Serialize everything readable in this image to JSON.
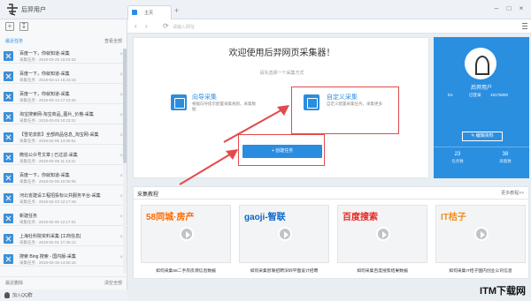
{
  "app": {
    "title": "后羿用户"
  },
  "tabs": [
    {
      "label": "主页"
    }
  ],
  "address": {
    "placeholder": "请输入网址"
  },
  "sidebar": {
    "section_title": "最近任务",
    "section_action": "查看全部",
    "tasks": [
      {
        "name": "百度一下，你就知道-采集",
        "date": "采集任务 · 2018-03-25 15:03:33"
      },
      {
        "name": "百度一下，你就知道-采集",
        "date": "采集任务 · 2018-03-14 15:23:16"
      },
      {
        "name": "百度一下，你就知道-采集",
        "date": "采集任务 · 2018-03-14 17:23:45"
      },
      {
        "name": "淘宝搜索网-淘宝商品_图片_价格-采集",
        "date": "采集任务 · 2018-03-08 10:23:21"
      },
      {
        "name": "【雪花泉影】全部商品信息_淘宝网-采集",
        "date": "采集任务 · 2018-02-06 14:09:51"
      },
      {
        "name": "微信公众号文章 | 已过滤-采集",
        "date": "采集任务 · 2018-02-06 11:13:31"
      },
      {
        "name": "百度一下，你就知道-采集",
        "date": "采集任务 · 2018-02-05 10:05:06"
      },
      {
        "name": "河北省建设工程招投标公共服务平台-采集",
        "date": "采集任务 · 2018-02-03 12:17:49"
      },
      {
        "name": "新建任务",
        "date": "采集任务 · 2018-02-06 12:17:01"
      },
      {
        "name": "上海社科院资料采集·[工商信息]",
        "date": "采集任务 · 2018-02-01 17:35:12"
      },
      {
        "name": "搜索 Bing 搜索 - 国内版-采集",
        "date": "采集任务 · 2018-03-19 14:50:16"
      }
    ],
    "footer_left": "最近删除",
    "footer_right": "清空全部",
    "qq_label": "加入QQ群"
  },
  "main": {
    "welcome": "欢迎使用后羿网页采集器！",
    "choose_hint": "请先选择一个采集方式",
    "cards": [
      {
        "title": "向导采集",
        "desc": "根据向导提示配置采集规则，采集数据"
      },
      {
        "title": "自定义采集",
        "desc": "自定义配置采集任务，采集更多"
      }
    ],
    "new_task_label": "创建任务"
  },
  "profile": {
    "name": "后羿用户",
    "level": "lv1",
    "status": "已登录",
    "phone": "15175000",
    "edit_label": "编辑资料",
    "stats": [
      {
        "value": "23",
        "label": "任务数"
      },
      {
        "value": "38",
        "label": "采集数"
      }
    ]
  },
  "tutorial": {
    "heading": "采集教程",
    "more": "更多教程>>",
    "items": [
      {
        "brand": "58同城·房产",
        "caption": "如何采集58二手房房源信息数据",
        "color": "#ff6a00"
      },
      {
        "brand": "gaoji-智联",
        "caption": "如何采集智联招聘深圳平面设计招聘",
        "color": "#0a65c8"
      },
      {
        "brand": "百度搜索",
        "caption": "如何采集百度搜索结果数据",
        "color": "#e6261f"
      },
      {
        "brand": "IT桔子",
        "caption": "如何采集IT桔子国内创业公司信息",
        "color": "#f28c1a"
      }
    ]
  },
  "watermark": "ITM下载网",
  "colors": {
    "accent": "#2a8de0",
    "highlight": "#e24b4b"
  }
}
